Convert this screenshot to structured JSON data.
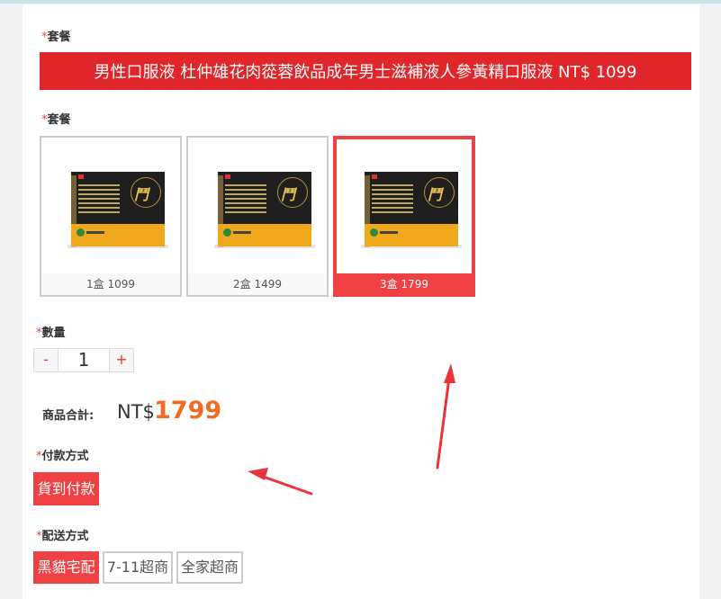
{
  "package_section": {
    "required_mark": "*",
    "label": "套餐",
    "banner_text": "男性口服液 杜仲雄花肉蓯蓉飲品成年男士滋補液人參黃精口服液 NT$ 1099"
  },
  "option_section": {
    "required_mark": "*",
    "label": "套餐",
    "options": [
      {
        "caption": "1盒 1099",
        "selected": false
      },
      {
        "caption": "2盒 1499",
        "selected": false
      },
      {
        "caption": "3盒 1799",
        "selected": true
      }
    ],
    "box_char": "鬥"
  },
  "quantity": {
    "required_mark": "*",
    "label": "數量",
    "minus": "-",
    "value": "1",
    "plus": "+"
  },
  "total": {
    "label": "商品合計:",
    "currency": "NT$",
    "amount": "1799"
  },
  "payment": {
    "required_mark": "*",
    "label": "付款方式",
    "options": [
      "貨到付款"
    ]
  },
  "shipping": {
    "required_mark": "*",
    "label": "配送方式",
    "options": [
      "黑貓宅配",
      "7-11超商",
      "全家超商"
    ]
  },
  "colors": {
    "accent_red": "#ef4144",
    "banner_red": "#e0262a",
    "price_orange": "#f36b21",
    "annotation_arrow": "#e8343a"
  }
}
